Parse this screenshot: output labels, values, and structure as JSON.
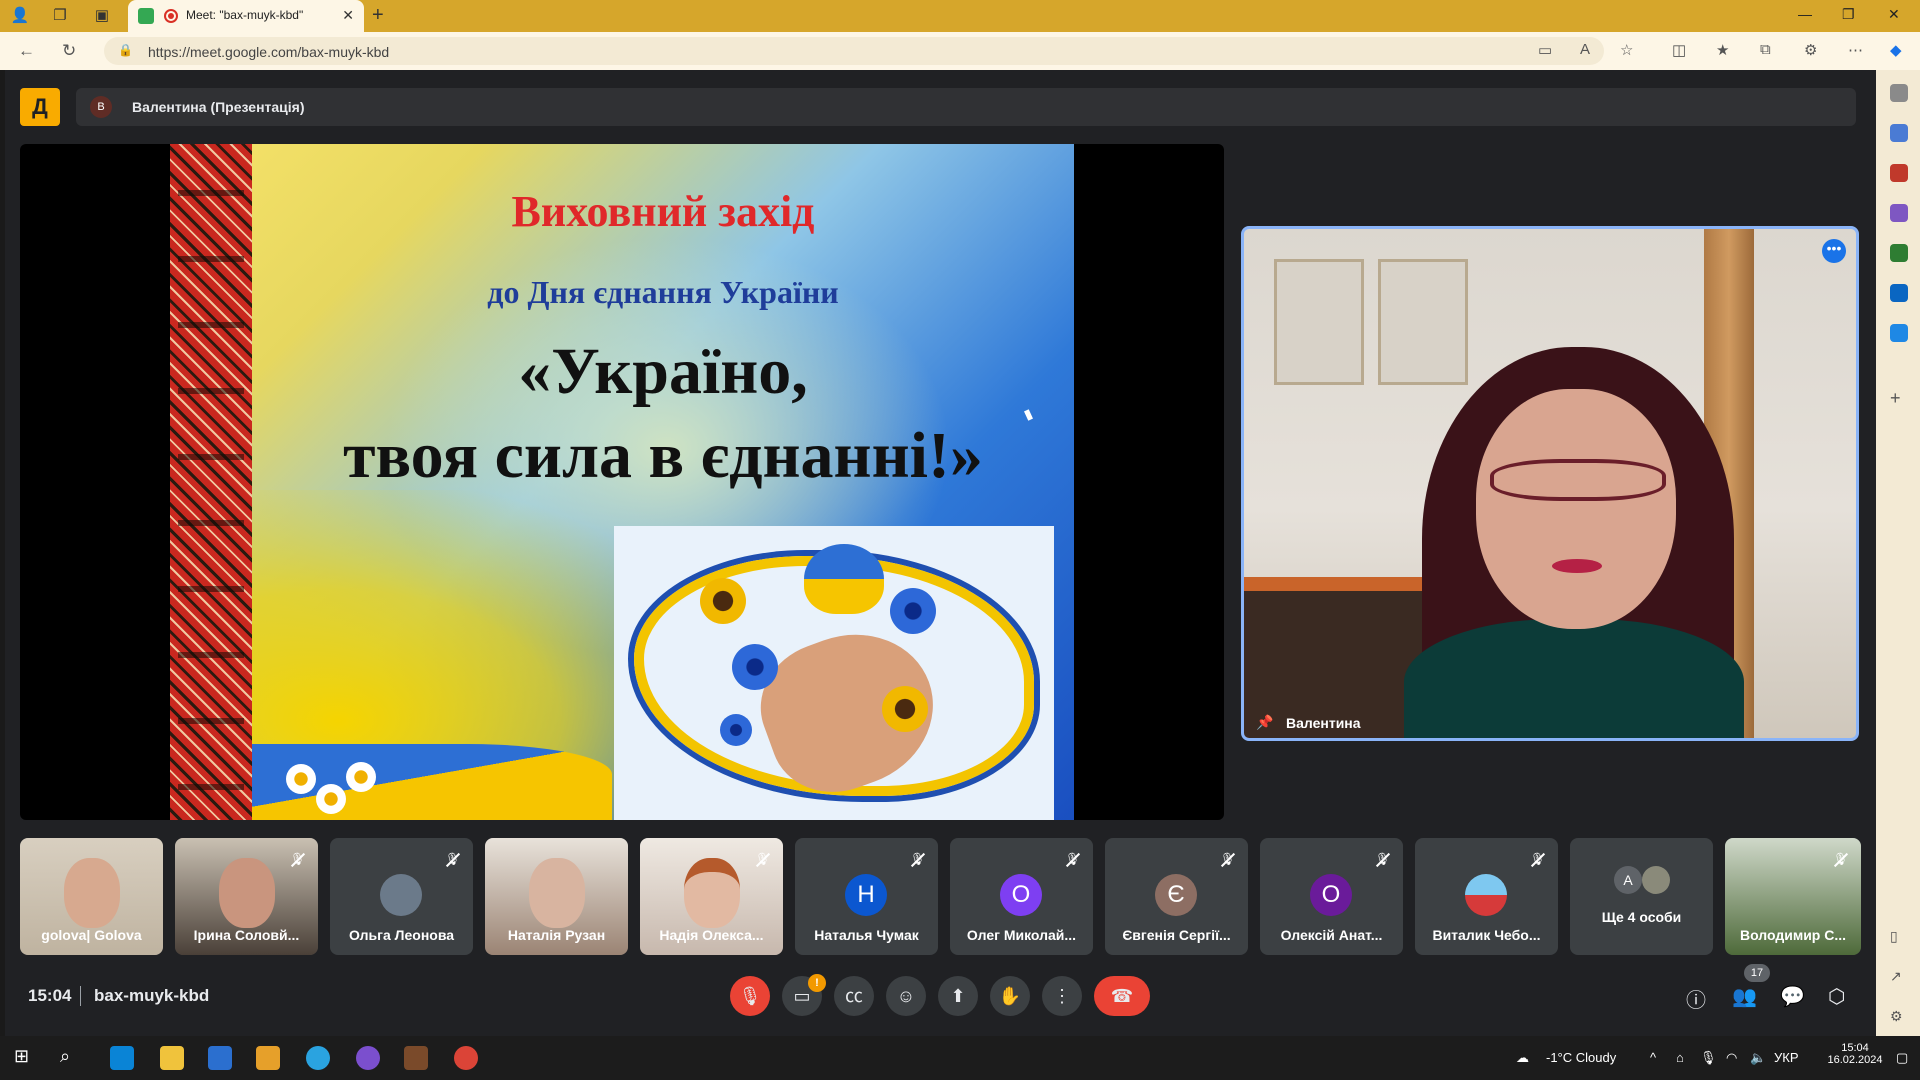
{
  "browser": {
    "tab_title": "Meet: \"bax-muyk-kbd\"",
    "url": "https://meet.google.com/bax-muyk-kbd"
  },
  "meet": {
    "presenter_initial": "В",
    "presenter_label": "Валентина (Презентація)",
    "logo_glyph": "Д",
    "speaker_name": "Валентина",
    "time": "15:04",
    "meeting_code": "bax-muyk-kbd",
    "camera_alert": "!",
    "people_count": "17"
  },
  "slide": {
    "line1": "Виховний захід",
    "line2": "до Дня єднання України",
    "line3": "«Україно,",
    "line4": "твоя сила в єднанні!»"
  },
  "participants": [
    {
      "name": "golova| Golova"
    },
    {
      "name": "Ірина Соловй..."
    },
    {
      "name": "Ольга Леонова"
    },
    {
      "name": "Наталія Рузан"
    },
    {
      "name": "Надія Олекса..."
    },
    {
      "name": "Наталья Чумак",
      "initial": "Н"
    },
    {
      "name": "Олег Миколай...",
      "initial": "О"
    },
    {
      "name": "Євгенія Сергії...",
      "initial": "Є"
    },
    {
      "name": "Олексій Анат...",
      "initial": "О"
    },
    {
      "name": "Виталик Чебо..."
    },
    {
      "name": "Ще 4 особи",
      "initial": "А"
    },
    {
      "name": "Володимир С..."
    }
  ],
  "taskbar": {
    "weather": "-1°C Cloudy",
    "lang": "УКР",
    "time": "15:04",
    "date": "16.02.2024"
  },
  "colors": {
    "accent": "#8ab4f8",
    "leave": "#ea4335",
    "brand": "#f9ab00",
    "avatar_blue": "#0b57d0",
    "avatar_purple": "#7e3ff2",
    "avatar_brown": "#8d6e63",
    "avatar_violet": "#6a1b9a"
  }
}
